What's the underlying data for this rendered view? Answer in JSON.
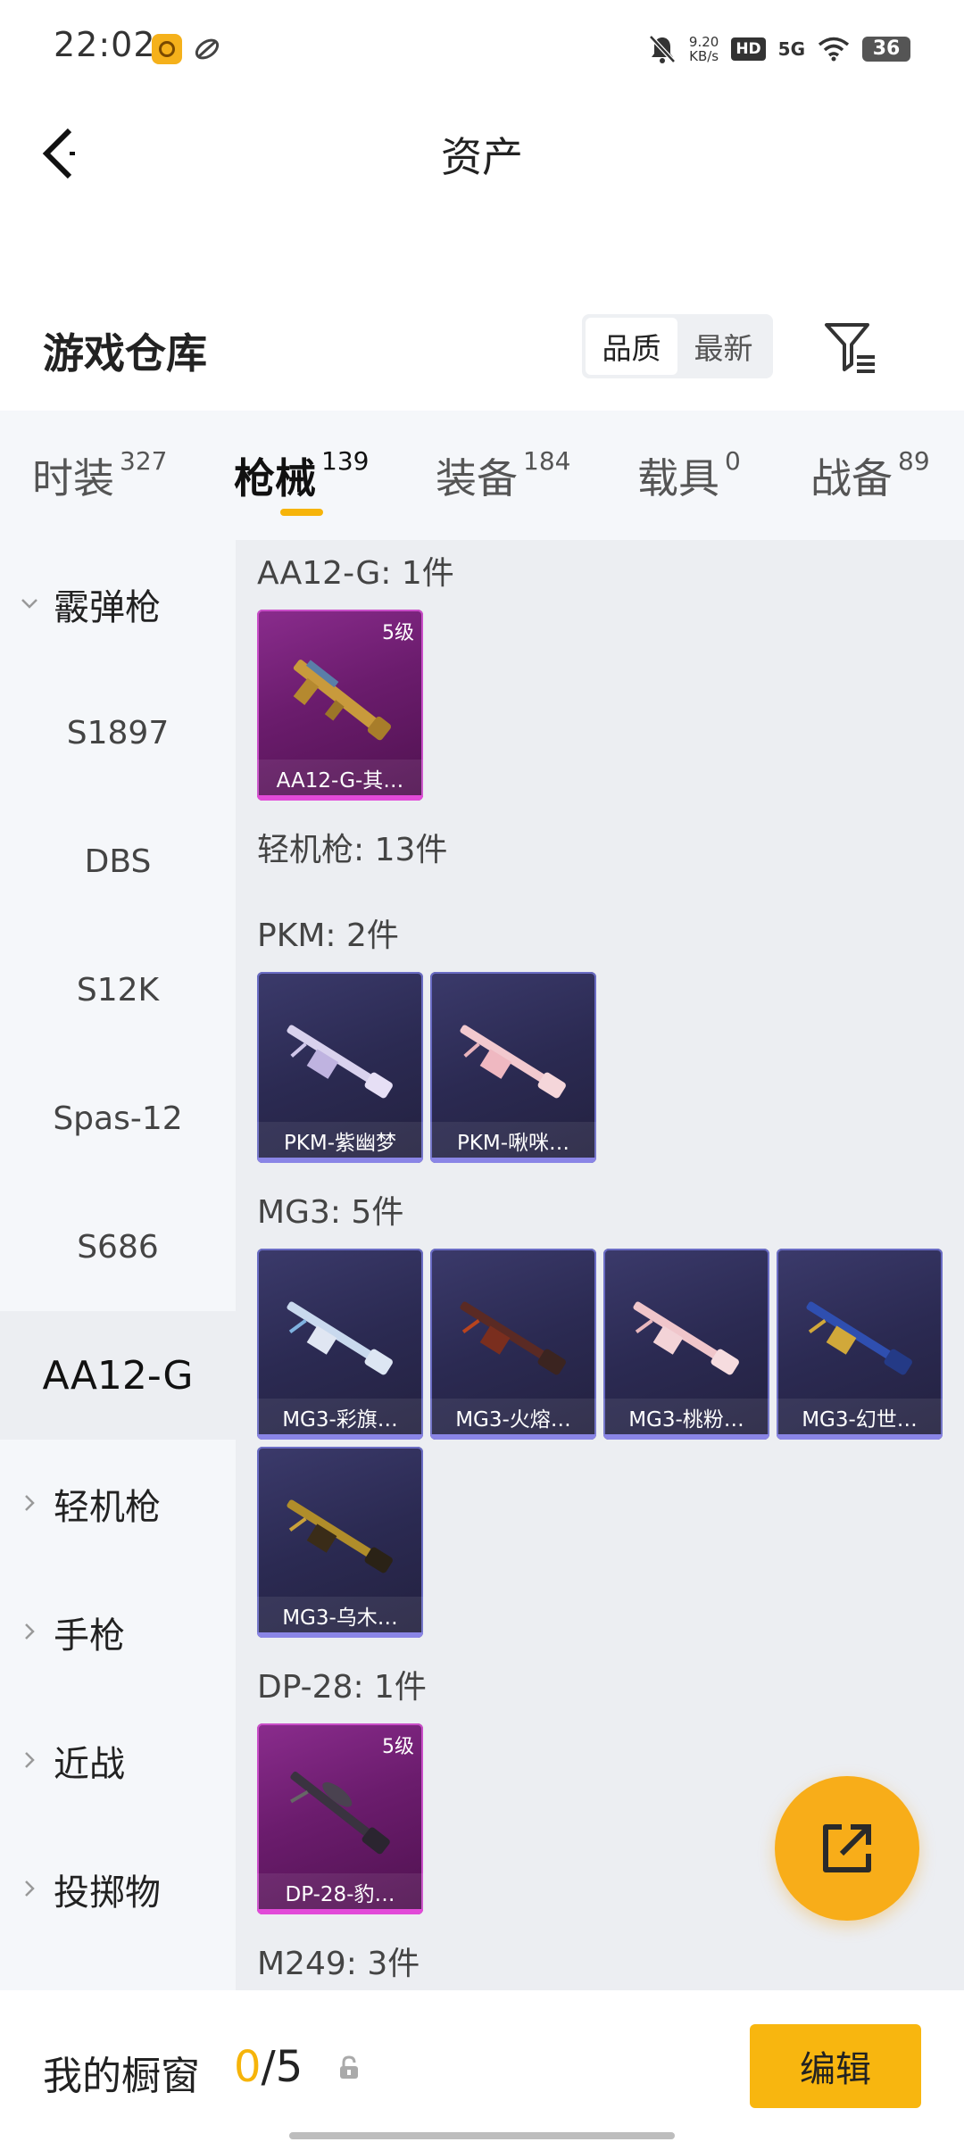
{
  "status_bar": {
    "time": "22:02",
    "net_speed_value": "9.20",
    "net_speed_unit": "KB/s",
    "hd": "HD",
    "signal": "5G",
    "battery": "36"
  },
  "header": {
    "title": "资产",
    "back_icon": "chevron-left-icon"
  },
  "section": {
    "title": "游戏仓库",
    "sort_quality": "品质",
    "sort_newest": "最新",
    "filter_icon": "filter-icon"
  },
  "tabs": [
    {
      "label": "时装",
      "count": "327"
    },
    {
      "label": "枪械",
      "count": "139"
    },
    {
      "label": "装备",
      "count": "184"
    },
    {
      "label": "载具",
      "count": "0"
    },
    {
      "label": "战备",
      "count": "89"
    }
  ],
  "categories": {
    "shotgun": "霰弹枪",
    "s1897": "S1897",
    "dbs": "DBS",
    "s12k": "S12K",
    "spas12": "Spas-12",
    "s686": "S686",
    "aa12g": "AA12-G",
    "lmg": "轻机枪",
    "pistol": "手枪",
    "melee": "近战",
    "throwable": "投掷物"
  },
  "groups": {
    "aa12g": {
      "title": "AA12-G: 1件",
      "items": [
        {
          "name": "AA12-G-其…",
          "level": "5级"
        }
      ]
    },
    "lmg_header": "轻机枪: 13件",
    "pkm": {
      "title": "PKM: 2件",
      "items": [
        {
          "name": "PKM-紫幽梦"
        },
        {
          "name": "PKM-啾咪…"
        }
      ]
    },
    "mg3": {
      "title": "MG3: 5件",
      "items": [
        {
          "name": "MG3-彩旗…"
        },
        {
          "name": "MG3-火熔…"
        },
        {
          "name": "MG3-桃粉…"
        },
        {
          "name": "MG3-幻世…"
        },
        {
          "name": "MG3-乌木…"
        }
      ]
    },
    "dp28": {
      "title": "DP-28: 1件",
      "items": [
        {
          "name": "DP-28-豹…",
          "level": "5级"
        }
      ]
    },
    "m249": {
      "title": "M249: 3件"
    }
  },
  "bottom": {
    "window_label": "我的橱窗",
    "current": "0",
    "separator_total": "/5",
    "edit": "编辑"
  },
  "colors": {
    "accent": "#f6b40a",
    "gold_card": "#7a2380",
    "purple_card": "#2d2c56"
  }
}
